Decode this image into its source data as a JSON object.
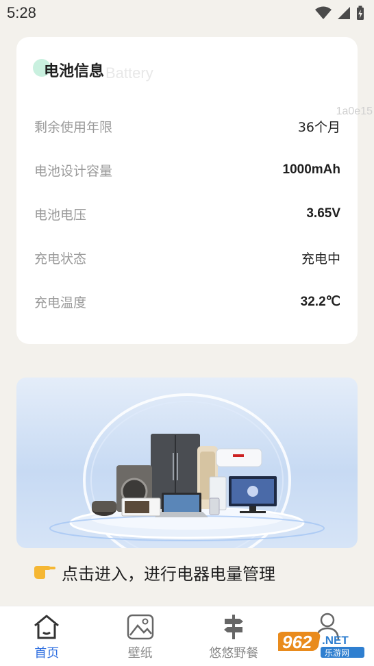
{
  "status": {
    "time": "5:28"
  },
  "battery_card": {
    "title": "电池信息",
    "watermark": "Battery",
    "watermark_code": "1a0e15",
    "rows": [
      {
        "label": "剩余使用年限",
        "value": "36个月"
      },
      {
        "label": "电池设计容量",
        "value": "1000mAh"
      },
      {
        "label": "电池电压",
        "value": "3.65V"
      },
      {
        "label": "充电状态",
        "value": "充电中"
      },
      {
        "label": "充电温度",
        "value": "32.2℃"
      }
    ]
  },
  "cta": {
    "icon": "pointing-hand-icon",
    "text": "点击进入，进行电器电量管理"
  },
  "nav": {
    "items": [
      {
        "label": "首页",
        "icon": "home-icon",
        "active": true
      },
      {
        "label": "壁纸",
        "icon": "image-icon",
        "active": false
      },
      {
        "label": "悠悠野餐",
        "icon": "signpost-icon",
        "active": false
      },
      {
        "label": "",
        "icon": "user-icon",
        "active": false
      }
    ]
  },
  "watermark_logo": {
    "number": "962",
    "suffix": ".NET",
    "site": "乐游网"
  },
  "colors": {
    "active": "#2f6fe0",
    "background": "#f3f1ec",
    "accent_dot": "#c9f0df"
  }
}
